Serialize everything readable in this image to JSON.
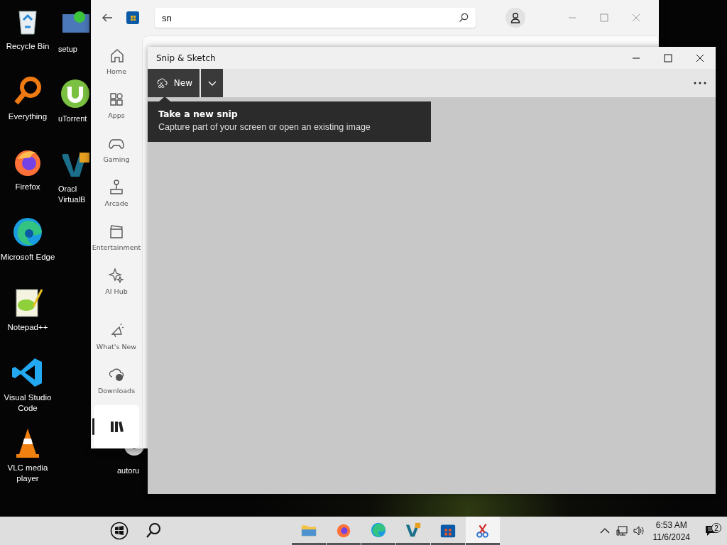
{
  "desktop_icons": [
    {
      "label": "Recycle Bin"
    },
    {
      "label": "Everything"
    },
    {
      "label": "Firefox"
    },
    {
      "label": "Microsoft Edge"
    },
    {
      "label": "Notepad++"
    },
    {
      "label": "Visual Studio Code"
    },
    {
      "label": "VLC media player"
    }
  ],
  "desktop_icons_behind": [
    {
      "label": "setup"
    },
    {
      "label": "uTorrent"
    },
    {
      "label": "Oracl VirtualB"
    },
    {
      "label": "autoru"
    }
  ],
  "store_window": {
    "search": {
      "value": "sn"
    },
    "nav_items": [
      {
        "label": "Home",
        "selected": false
      },
      {
        "label": "Apps",
        "selected": false
      },
      {
        "label": "Gaming",
        "selected": false
      },
      {
        "label": "Arcade",
        "selected": false
      },
      {
        "label": "Entertainment",
        "selected": false
      },
      {
        "label": "AI Hub",
        "selected": false
      },
      {
        "label": "What's New",
        "selected": false
      },
      {
        "label": "Downloads",
        "selected": false
      },
      {
        "selected": true
      }
    ]
  },
  "snip_window": {
    "title": "Snip & Sketch",
    "new_button": "New",
    "tooltip": {
      "title": "Take a new snip",
      "text": "Capture part of your screen or open an existing image"
    }
  },
  "taskbar": {
    "apps": [
      {
        "selected": false
      },
      {
        "selected": false
      },
      {
        "selected": false
      },
      {
        "selected": false
      },
      {
        "selected": false
      },
      {
        "selected": true
      }
    ],
    "clock": {
      "time": "6:53 AM",
      "date": "11/6/2024"
    },
    "notifications": {
      "count": "2"
    }
  }
}
